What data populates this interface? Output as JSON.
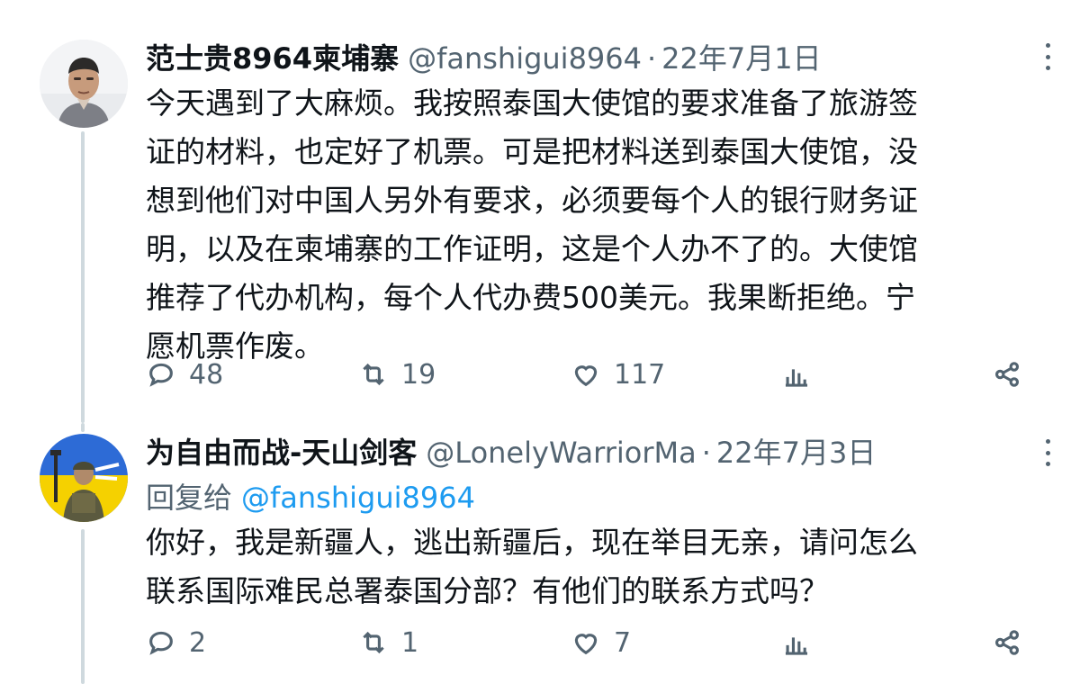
{
  "tweets": [
    {
      "display_name": "范士贵8964柬埔寨",
      "handle": "@fanshigui8964",
      "separator": "·",
      "date": "22年7月1日",
      "body_lines": [
        "今天遇到了大麻烦。我按照泰国大使馆的要求准备了旅游签",
        "证的材料，也定好了机票。可是把材料送到泰国大使馆，没",
        "想到他们对中国人另外有要求，必须要每个人的银行财务证",
        "明，以及在柬埔寨的工作证明，这是个人办不了的。大使馆",
        "推荐了代办机构，每个人代办费500美元。我果断拒绝。宁",
        "愿机票作废。"
      ],
      "replies": "48",
      "retweets": "19",
      "likes": "117",
      "avatar_icon": "person-photo-avatar"
    },
    {
      "display_name": "为自由而战-天山剑客",
      "handle": "@LonelyWarriorMa",
      "separator": "·",
      "date": "22年7月3日",
      "reply_prefix": "回复给",
      "reply_handle": "@fanshigui8964",
      "body_lines": [
        "你好，我是新疆人，逃出新疆后，现在举目无亲，请问怎么",
        "联系国际难民总署泰国分部？有他们的联系方式吗？"
      ],
      "replies": "2",
      "retweets": "1",
      "likes": "7",
      "avatar_icon": "soldier-photo-avatar"
    }
  ],
  "colors": {
    "text": "#0f1419",
    "secondary": "#536471",
    "link": "#1d9bf0",
    "thread_line": "#cfd9de"
  }
}
